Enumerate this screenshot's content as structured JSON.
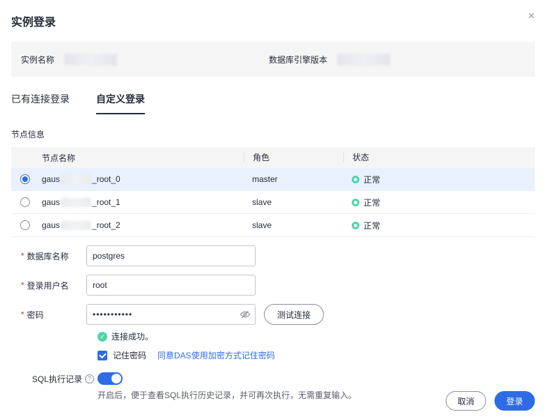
{
  "dialog": {
    "title": "实例登录",
    "close_icon": "×"
  },
  "info_bar": {
    "instance_name_label": "实例名称",
    "engine_version_label": "数据库引擎版本"
  },
  "tabs": [
    {
      "label": "已有连接登录",
      "active": false
    },
    {
      "label": "自定义登录",
      "active": true
    }
  ],
  "node_section": {
    "title": "节点信息",
    "columns": [
      "节点名称",
      "角色",
      "状态"
    ],
    "rows": [
      {
        "name_prefix": "gaus",
        "name_suffix": "_root_0",
        "role": "master",
        "status": "正常",
        "selected": true
      },
      {
        "name_prefix": "gaus",
        "name_suffix": "_root_1",
        "role": "slave",
        "status": "正常",
        "selected": false
      },
      {
        "name_prefix": "gaus",
        "name_suffix": "_root_2",
        "role": "slave",
        "status": "正常",
        "selected": false
      }
    ]
  },
  "form": {
    "required_marker": "*",
    "db_name": {
      "label": "数据库名称",
      "value": "postgres"
    },
    "username": {
      "label": "登录用户名",
      "value": "root"
    },
    "password": {
      "label": "密码",
      "masked_value": "•••••••••••"
    },
    "test_connection_button": "测试连接",
    "connection_success_message": "连接成功。",
    "remember_password": {
      "label": "记住密码",
      "agreement_link": "同意DAS使用加密方式记住密码",
      "checked": true
    },
    "sql_record": {
      "label": "SQL执行记录",
      "enabled": true,
      "hint": "开启后，便于查看SQL执行历史记录，并可再次执行，无需重复输入。"
    }
  },
  "footer": {
    "cancel_label": "取消",
    "login_label": "登录"
  },
  "colors": {
    "primary": "#2e6be6",
    "success": "#50d4ab",
    "required": "#e02929",
    "selected_row": "#e8f1fc"
  }
}
